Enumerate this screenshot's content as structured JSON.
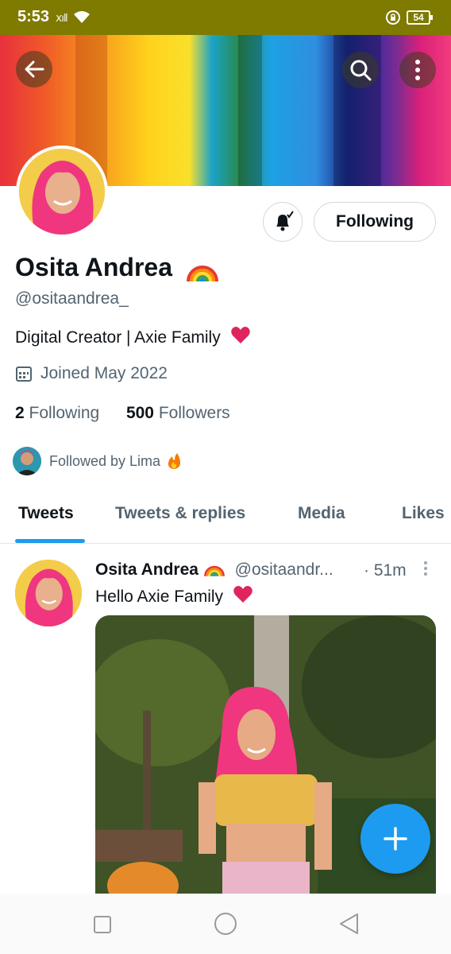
{
  "status_bar": {
    "time": "5:53",
    "battery": "54"
  },
  "profile": {
    "name": "Osita Andrea",
    "handle": "@ositaandrea_",
    "bio": "Digital Creator | Axie Family",
    "joined": "Joined May 2022",
    "following_count": "2",
    "following_label": "Following",
    "followers_count": "500",
    "followers_label": "Followers",
    "followed_by": "Followed by Lima",
    "follow_button_label": "Following"
  },
  "tabs": [
    {
      "label": "Tweets",
      "active": true
    },
    {
      "label": "Tweets & replies",
      "active": false
    },
    {
      "label": "Media",
      "active": false
    },
    {
      "label": "Likes",
      "active": false
    }
  ],
  "tweet": {
    "name": "Osita Andrea",
    "handle": "@ositaandr...",
    "time": "· 51m",
    "text": "Hello Axie Family"
  },
  "icons": [
    "back-arrow-icon",
    "search-icon",
    "more-vertical-icon",
    "notification-bell-icon",
    "calendar-icon",
    "rainbow-emoji-icon",
    "heart-emoji-icon",
    "fire-emoji-icon",
    "compose-plus-icon",
    "nav-recents-icon",
    "nav-home-icon",
    "nav-back-icon"
  ],
  "colors": {
    "accent": "#1d9bf0",
    "status_bar": "#7f7a00",
    "secondary_text": "#536471"
  }
}
